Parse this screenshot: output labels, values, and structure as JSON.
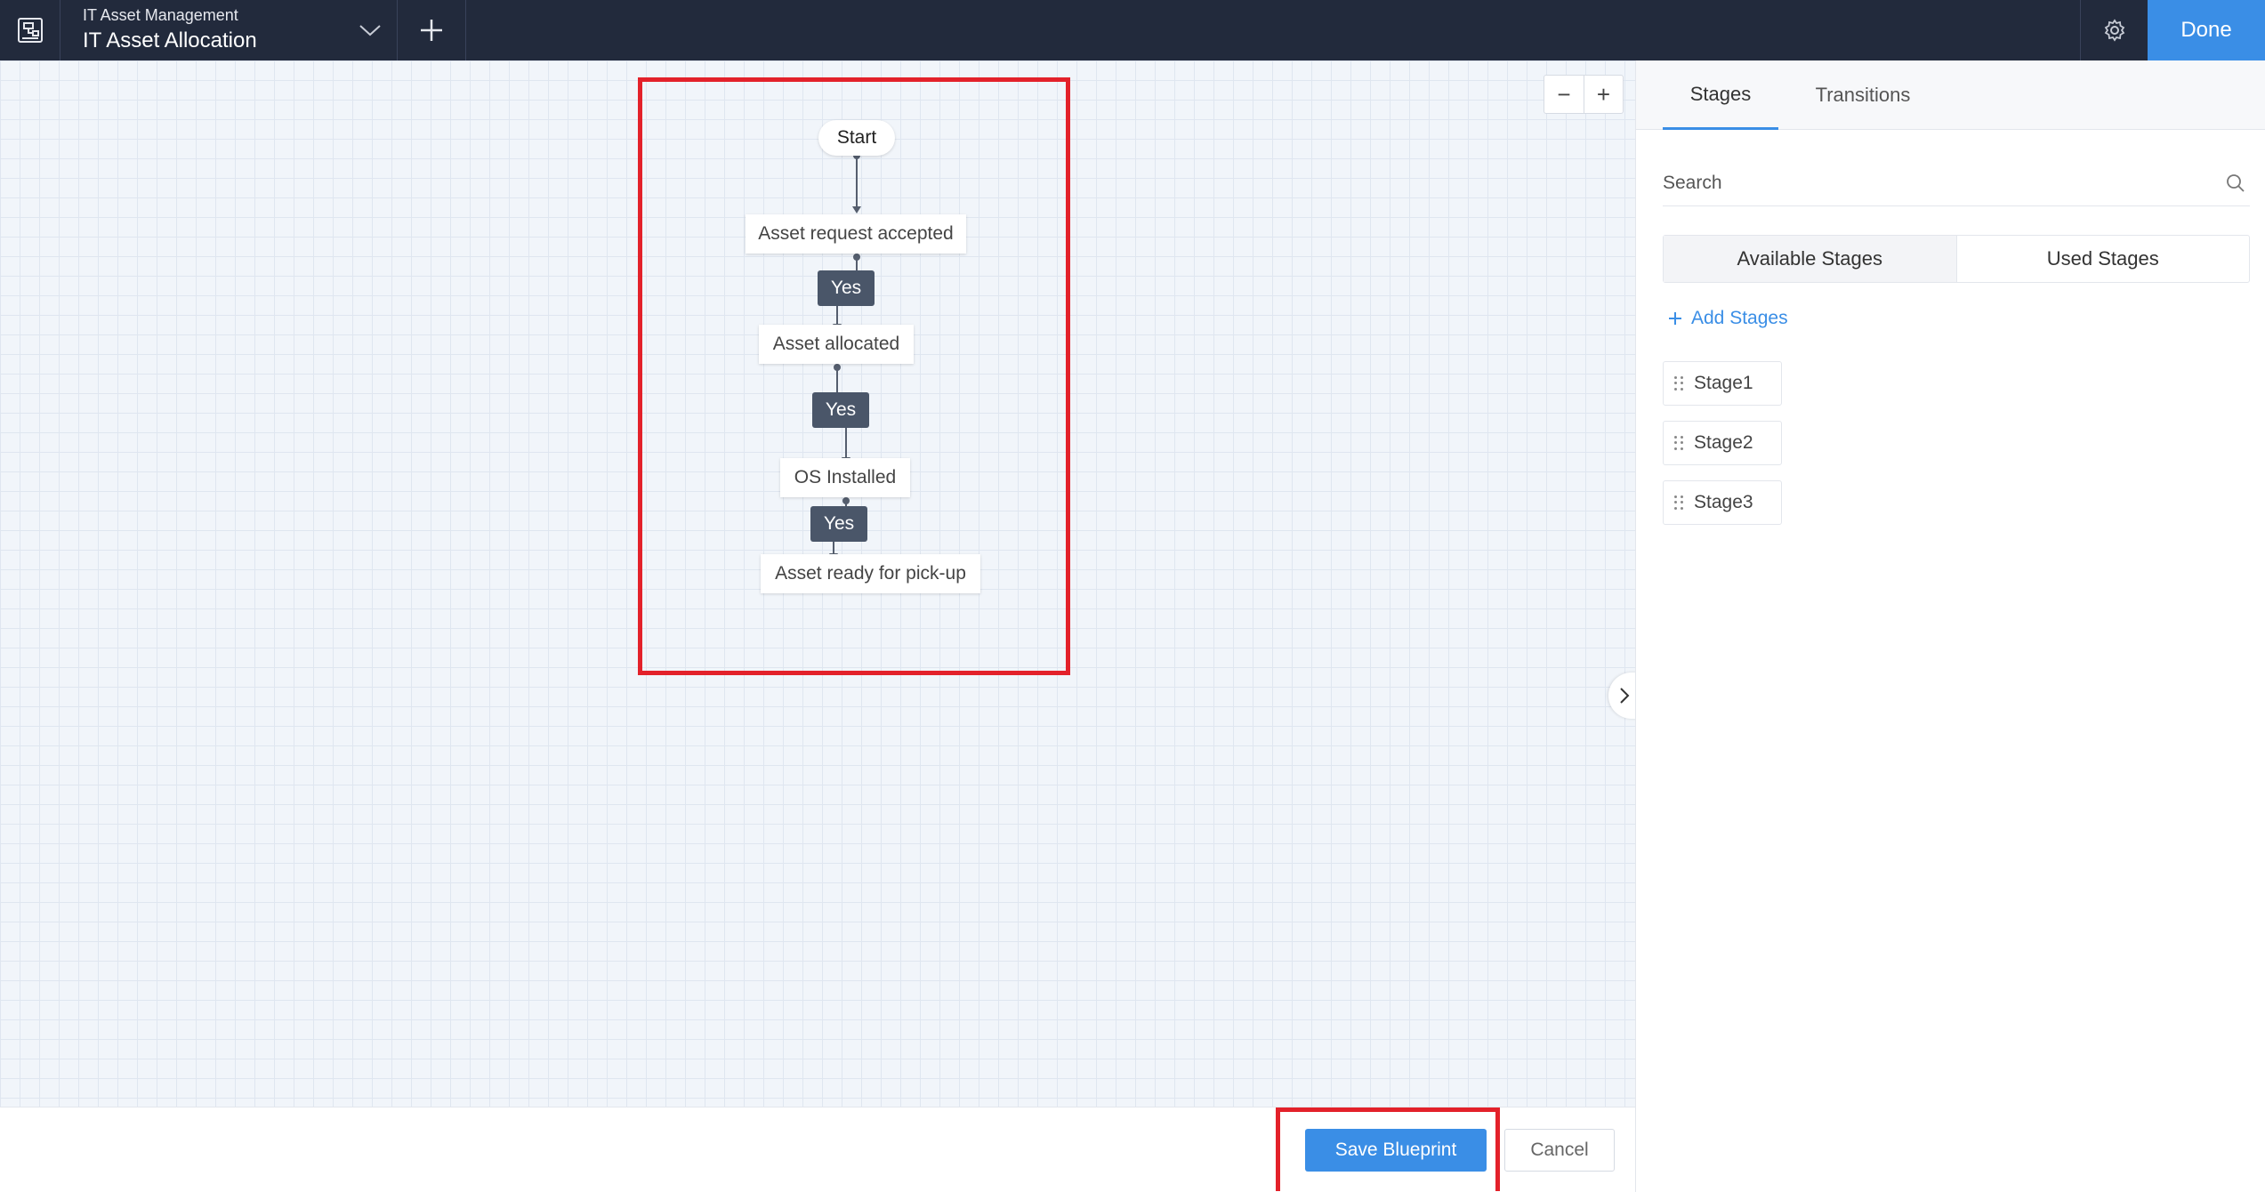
{
  "header": {
    "subtitle": "IT Asset Management",
    "title": "IT Asset Allocation",
    "done_label": "Done"
  },
  "canvas": {
    "zoom_out_label": "−",
    "zoom_in_label": "+"
  },
  "flow": {
    "start": "Start",
    "states": [
      "Asset request accepted",
      "Asset allocated",
      "OS Installed",
      "Asset ready for pick-up"
    ],
    "transitions": [
      "Yes",
      "Yes",
      "Yes"
    ]
  },
  "footer": {
    "save_label": "Save Blueprint",
    "cancel_label": "Cancel"
  },
  "panel": {
    "tabs": [
      {
        "label": "Stages",
        "active": true
      },
      {
        "label": "Transitions",
        "active": false
      }
    ],
    "search_placeholder": "Search",
    "segments": [
      {
        "label": "Available Stages",
        "active": true
      },
      {
        "label": "Used Stages",
        "active": false
      }
    ],
    "add_stages_label": "Add Stages",
    "stages": [
      "Stage1",
      "Stage2",
      "Stage3"
    ]
  },
  "colors": {
    "topbar": "#222a3c",
    "accent": "#3a8ee6",
    "transition_node": "#4a5669",
    "highlight": "#e3212a"
  },
  "icons": {
    "app": "blueprint-icon",
    "dropdown": "chevron-down-icon",
    "add": "plus-icon",
    "settings": "gear-icon",
    "collapse": "chevron-right-icon",
    "search": "search-icon",
    "drag": "drag-handle-icon"
  }
}
